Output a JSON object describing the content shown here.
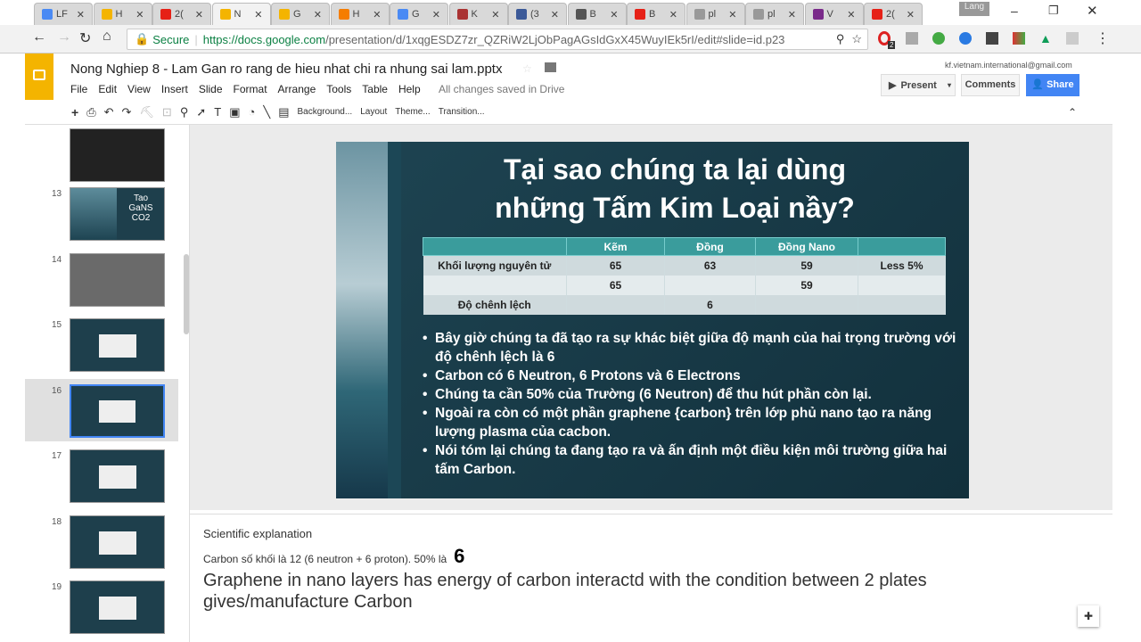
{
  "browser": {
    "tabs": [
      {
        "label": "LF",
        "color": "#4a8af4"
      },
      {
        "label": "H",
        "color": "#f4b400"
      },
      {
        "label": "2(",
        "color": "#e62117"
      },
      {
        "label": "N",
        "color": "#f4b400",
        "active": true
      },
      {
        "label": "G",
        "color": "#f4b400"
      },
      {
        "label": "H",
        "color": "#f57d00"
      },
      {
        "label": "G",
        "color": "#4a8af4"
      },
      {
        "label": "K",
        "color": "#a33"
      },
      {
        "label": "(3",
        "color": "#3b5998"
      },
      {
        "label": "B",
        "color": "#555"
      },
      {
        "label": "B",
        "color": "#e62117"
      },
      {
        "label": "pl",
        "color": "#999"
      },
      {
        "label": "pl",
        "color": "#999"
      },
      {
        "label": "V",
        "color": "#7a2a8a"
      },
      {
        "label": "2(",
        "color": "#e62117"
      }
    ],
    "user_label": "Lang",
    "secure_label": "Secure",
    "url_host": "https://docs.google.com",
    "url_path": "/presentation/d/1xqgESDZ7zr_QZRiW2LjObPagAGsIdGxX45WuyIEk5rI/edit#slide=id.p23",
    "ext_badge": "2"
  },
  "doc": {
    "title": "Nong Nghiep 8 - Lam Gan ro rang de hieu nhat chi ra nhung sai lam.pptx",
    "account": "kf.vietnam.international@gmail.com",
    "menu": [
      "File",
      "Edit",
      "View",
      "Insert",
      "Slide",
      "Format",
      "Arrange",
      "Tools",
      "Table",
      "Help"
    ],
    "save_status": "All changes saved in Drive",
    "present": "Present",
    "comments": "Comments",
    "share": "Share"
  },
  "toolbar": {
    "background": "Background...",
    "layout": "Layout",
    "theme": "Theme...",
    "transition": "Transition..."
  },
  "filmstrip": {
    "slides": [
      {
        "num": "13",
        "text": "Tao GaNS CO2"
      },
      {
        "num": "14"
      },
      {
        "num": "15"
      },
      {
        "num": "16",
        "selected": true
      },
      {
        "num": "17"
      },
      {
        "num": "18"
      },
      {
        "num": "19"
      }
    ]
  },
  "slide": {
    "title_line1": "Tại sao chúng ta lại dùng",
    "title_line2": "những Tấm Kim Loại nầy?",
    "table": {
      "headers": [
        "",
        "Kẽm",
        "Đồng",
        "Đồng Nano",
        ""
      ],
      "rows": [
        [
          "Khối lượng nguyên tử",
          "65",
          "63",
          "59",
          "Less 5%"
        ],
        [
          "",
          "65",
          "",
          "59",
          ""
        ],
        [
          "Độ chênh lệch",
          "",
          "6",
          "",
          ""
        ]
      ]
    },
    "bullets": [
      "Bây giờ chúng ta đã tạo ra sự khác biệt giữa độ mạnh của hai trọng trường với độ chênh lệch là 6",
      "Carbon có 6 Neutron, 6 Protons và 6 Electrons",
      "Chúng ta cần 50% của Trường (6 Neutron) để thu hút phần còn lại.",
      "Ngoài ra còn có một phần graphene {carbon} trên lớp phủ nano tạo ra năng lượng plasma của cacbon.",
      "Nói tóm lại chúng ta đang tạo ra và ấn định một điều kiện môi trường giữa hai tấm Carbon."
    ]
  },
  "notes": {
    "line1": "Scientific explanation",
    "line2": "Carbon số khối là 12 (6 neutron + 6 proton). 50% là",
    "line2_big": "6",
    "line3": "Graphene in nano layers has energy of carbon interactd with the condition between 2 plates gives/manufacture Carbon"
  }
}
